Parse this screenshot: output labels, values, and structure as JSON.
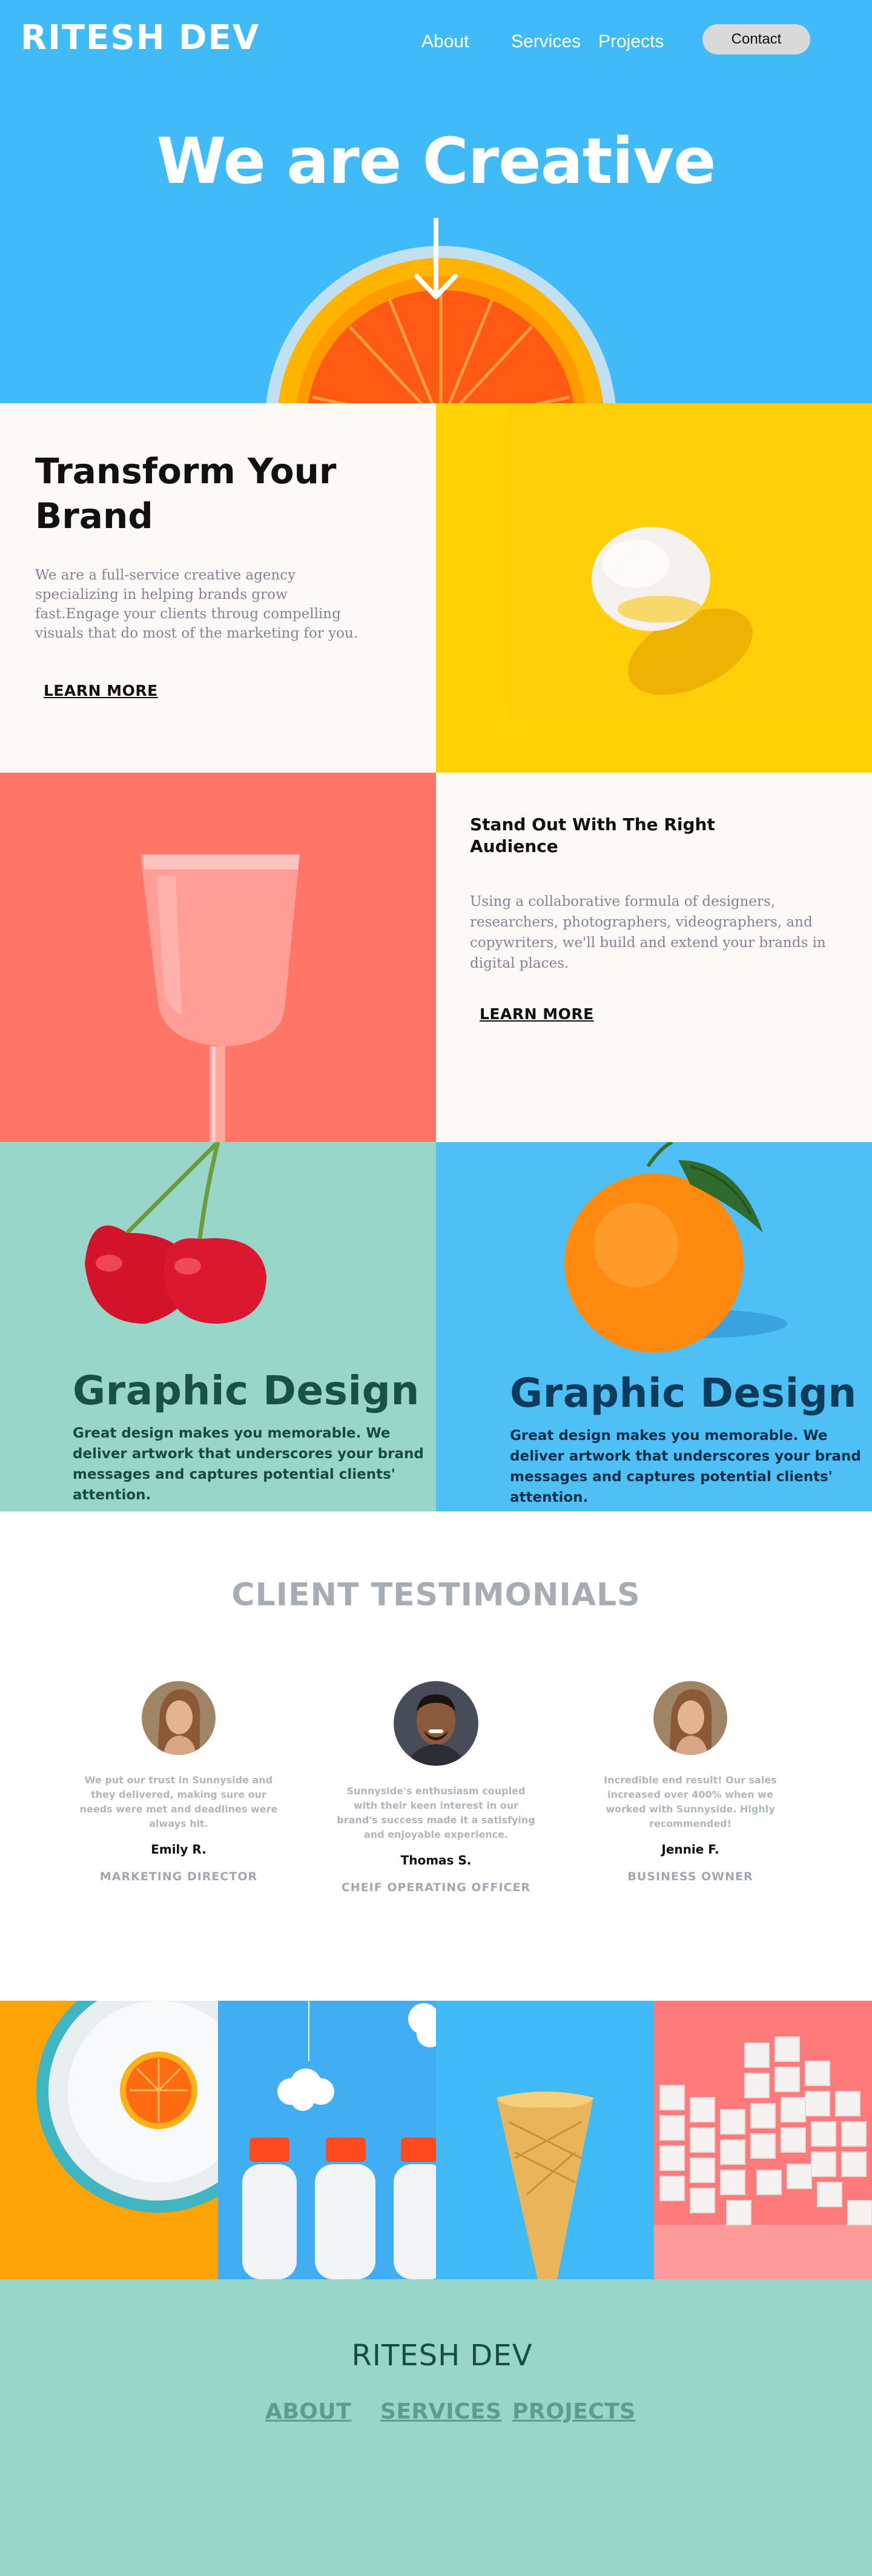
{
  "brand": {
    "logo": "RITESH DEV"
  },
  "nav": {
    "about": "About",
    "services": "Services",
    "projects": "Projects",
    "contact": "Contact"
  },
  "hero": {
    "title": "We are Creative"
  },
  "transform": {
    "title": "Transform Your Brand",
    "text": "We are a full-service creative agency specializing in helping brands grow fast.Engage your clients throug compelling visuals that do most of the marketing for you.",
    "cta": "LEARN MORE"
  },
  "standout": {
    "title": "Stand Out With The Right Audience",
    "text": "Using a collaborative formula of designers, researchers, photographers, videographers, and copywriters, we'll build and extend your brands in digital places.",
    "cta": "LEARN MORE"
  },
  "graphic_design": {
    "left": {
      "title": "Graphic Design",
      "text": "Great design makes you memorable. We deliver artwork that underscores your brand messages and captures potential clients' attention."
    },
    "right": {
      "title": "Graphic Design",
      "text": "Great design makes you memorable. We deliver artwork that underscores your brand messages and captures potential clients' attention."
    }
  },
  "testimonials": {
    "title": "CLIENT TESTIMONIALS",
    "items": [
      {
        "quote": "We put our trust in Sunnyside and they delivered, making sure our needs were met and deadlines were always hit.",
        "name": "Emily R.",
        "role": "MARKETING DIRECTOR"
      },
      {
        "quote": "Sunnyside's enthusiasm coupled with their keen interest in our brand's success made it a satisfying and enjoyable experience.",
        "name": "Thomas S.",
        "role": "CHEIF OPERATING OFFICER"
      },
      {
        "quote": "Incredible end result! Our sales increased over 400% when we worked with Sunnyside. Highly recommended!",
        "name": "Jennie F.",
        "role": "BUSINESS OWNER"
      }
    ]
  },
  "footer": {
    "logo": "RITESH DEV",
    "about": "ABOUT",
    "services": "SERVICES",
    "projects": "PROJECTS"
  },
  "colors": {
    "hero_bg": "#41bbf7",
    "yellow": "#ffd305",
    "coral": "#ff7567",
    "mint": "#97d6c8",
    "sky": "#4fc0f5",
    "cream": "#fdf9f6"
  }
}
